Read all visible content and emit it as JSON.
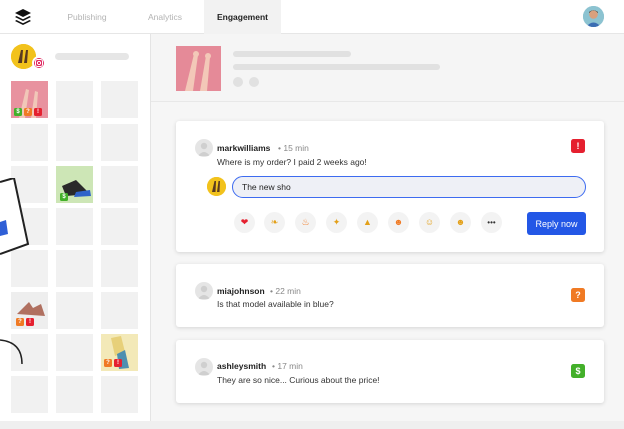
{
  "nav": {
    "tabs": [
      {
        "label": "Publishing"
      },
      {
        "label": "Analytics"
      },
      {
        "label": "Engagement"
      }
    ]
  },
  "colors": {
    "accent": "#2357e6",
    "tag_red": "#e5202f",
    "tag_orange": "#f07a24",
    "tag_green": "#43b02a"
  },
  "sidebar": {
    "account_icon": "instagram-icon",
    "grid_badges": {
      "post_1": [
        "$",
        "?",
        "!"
      ],
      "post_2": [
        "$"
      ],
      "post_3": [
        "?",
        "!"
      ],
      "post_4": [
        "?",
        "!"
      ]
    }
  },
  "comments": [
    {
      "username": "markwilliams",
      "time": "• 15 min",
      "text": "Where is my order? I paid 2 weeks ago!",
      "tag": "!",
      "tag_color": "#e5202f"
    },
    {
      "username": "miajohnson",
      "time": "• 22 min",
      "text": "Is that model available in blue?",
      "tag": "?",
      "tag_color": "#f07a24"
    },
    {
      "username": "ashleysmith",
      "time": "• 17 min",
      "text": "They are so nice... Curious about the price!",
      "tag": "$",
      "tag_color": "#43b02a"
    }
  ],
  "reply": {
    "value": "The new sho",
    "button_label": "Reply now",
    "reactions": [
      "heart-icon",
      "hands-icon",
      "fire-icon",
      "clap-icon",
      "pray-icon",
      "heart-eyes-icon",
      "smile-icon",
      "laugh-icon",
      "more-icon"
    ],
    "more_label": "•••"
  }
}
